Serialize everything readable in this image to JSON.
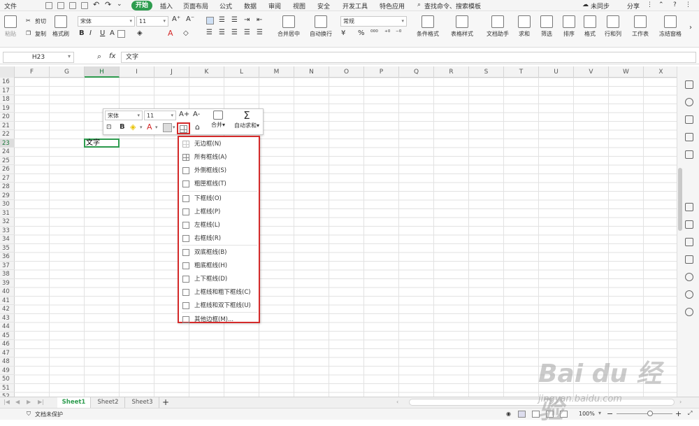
{
  "menu": {
    "file": "文件",
    "tabs": [
      "开始",
      "插入",
      "页面布局",
      "公式",
      "数据",
      "审阅",
      "视图",
      "安全",
      "开发工具",
      "特色应用"
    ],
    "search": "查找命令、搜索模板",
    "sync": "未同步",
    "share": "分享"
  },
  "ribbon": {
    "paste": "粘贴",
    "cut": "剪切",
    "copy": "复制",
    "format_painter": "格式刷",
    "font": "宋体",
    "size": "11",
    "merge": "合并居中",
    "wrap": "自动换行",
    "number_format": "常规",
    "conditional_format": "条件格式",
    "table_style": "表格样式",
    "doc_helper": "文档助手",
    "sum": "求和",
    "filter": "筛选",
    "sort": "排序",
    "format": "格式",
    "rows_cols": "行和列",
    "worksheet": "工作表",
    "freeze": "冻结窗格"
  },
  "formula": {
    "cell_ref": "H23",
    "fx": "fx",
    "content": "文字"
  },
  "columns": [
    "F",
    "G",
    "H",
    "I",
    "J",
    "K",
    "L",
    "M",
    "N",
    "O",
    "P",
    "Q",
    "R",
    "S",
    "T",
    "U",
    "V",
    "W",
    "X"
  ],
  "active_column": "H",
  "rows": [
    "16",
    "17",
    "18",
    "19",
    "20",
    "21",
    "22",
    "23",
    "24",
    "25",
    "26",
    "27",
    "28",
    "29",
    "30",
    "31",
    "32",
    "33",
    "34",
    "35",
    "36",
    "37",
    "38",
    "39",
    "40",
    "41",
    "42",
    "43",
    "44",
    "45",
    "46",
    "47",
    "48",
    "49",
    "50",
    "51",
    "52"
  ],
  "active_row": "23",
  "cell_value": "文字",
  "mini_toolbar": {
    "font": "宋体",
    "size": "11",
    "grow": "A+",
    "shrink": "A-",
    "bold": "B",
    "font_color": "A",
    "merge": "合并",
    "autosum": "自动求和"
  },
  "border_menu": [
    "无边框(N)",
    "所有框线(A)",
    "外侧框线(S)",
    "粗匣框线(T)",
    "下框线(O)",
    "上框线(P)",
    "左框线(L)",
    "右框线(R)",
    "双底框线(B)",
    "粗底框线(H)",
    "上下框线(D)",
    "上框线和粗下框线(C)",
    "上框线和双下框线(U)",
    "其他边框(M)..."
  ],
  "sheets": [
    "Sheet1",
    "Sheet2",
    "Sheet3"
  ],
  "active_sheet": "Sheet1",
  "add_sheet": "+",
  "status": {
    "protect": "文档未保护",
    "zoom": "100%"
  },
  "watermark": {
    "brand": "Bai du 经验",
    "url": "jingyan.baidu.com"
  },
  "colors": {
    "accent": "#2e9c4f",
    "highlight_box": "#d42a2a"
  }
}
